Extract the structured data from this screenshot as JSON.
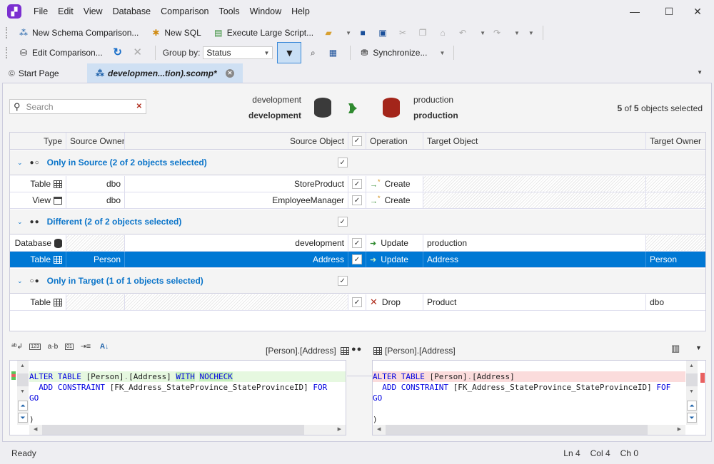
{
  "app": {
    "logo_icon": "devart-dbforge-logo-icon"
  },
  "menu": [
    "File",
    "Edit",
    "View",
    "Database",
    "Comparison",
    "Tools",
    "Window",
    "Help"
  ],
  "window_controls": {
    "minimize": "—",
    "maximize": "☐",
    "close": "✕"
  },
  "toolbar1": {
    "new_schema_comparison": "New Schema Comparison...",
    "new_sql": "New SQL",
    "execute_large_script": "Execute Large Script..."
  },
  "toolbar2": {
    "edit_comparison": "Edit Comparison...",
    "group_by_label": "Group by:",
    "group_by_value": "Status",
    "synchronize": "Synchronize..."
  },
  "tabs": [
    {
      "label": "Start Page",
      "active": false
    },
    {
      "label": "developmen...tion).scomp*",
      "active": true
    }
  ],
  "search": {
    "placeholder": "Search",
    "clear": "✕"
  },
  "source": {
    "connection": "development",
    "database": "development",
    "color": "#3a3a3a"
  },
  "target": {
    "connection": "production",
    "database": "production",
    "color": "#a3251a"
  },
  "direction_arrow_color": "#2f8a2f",
  "selection_summary": {
    "selected": "5",
    "of": "of",
    "total": "5",
    "suffix": "objects selected"
  },
  "grid": {
    "columns": [
      "Type",
      "Source Owner",
      "Source Object",
      "",
      "Operation",
      "Target Object",
      "Target Owner"
    ],
    "groups": [
      {
        "label": "Only in Source (2 of 2 objects selected)",
        "dots": "●○",
        "rows": [
          {
            "type": "Table",
            "type_icon": "table-icon",
            "source_owner": "dbo",
            "source_object": "StoreProduct",
            "checked": true,
            "operation": "Create",
            "op_icon": "create-icon",
            "target_object": "",
            "target_owner": ""
          },
          {
            "type": "View",
            "type_icon": "view-icon",
            "source_owner": "dbo",
            "source_object": "EmployeeManager",
            "checked": true,
            "operation": "Create",
            "op_icon": "create-icon",
            "target_object": "",
            "target_owner": ""
          }
        ]
      },
      {
        "label": "Different (2 of 2 objects selected)",
        "dots": "●●",
        "rows": [
          {
            "type": "Database",
            "type_icon": "database-icon",
            "source_owner": "",
            "source_object": "development",
            "checked": true,
            "operation": "Update",
            "op_icon": "update-icon",
            "target_object": "production",
            "target_owner": ""
          },
          {
            "type": "Table",
            "type_icon": "table-icon",
            "source_owner": "Person",
            "source_object": "Address",
            "checked": true,
            "operation": "Update",
            "op_icon": "update-icon",
            "target_object": "Address",
            "target_owner": "Person",
            "selected": true
          }
        ]
      },
      {
        "label": "Only in Target (1 of 1 objects selected)",
        "dots": "○●",
        "rows": [
          {
            "type": "Table",
            "type_icon": "table-icon",
            "source_owner": "",
            "source_object": "",
            "checked": true,
            "operation": "Drop",
            "op_icon": "drop-icon",
            "target_object": "Product",
            "target_owner": "dbo"
          }
        ]
      }
    ]
  },
  "diff": {
    "left_title": "[Person].[Address]",
    "right_title": "[Person].[Address]",
    "compare_dots": "●●",
    "left_code": [
      {
        "parts": [
          {
            "t": "ALTER TABLE ",
            "k": 1
          },
          {
            "t": "[Person]"
          },
          {
            "t": ".",
            "g": 1
          },
          {
            "t": "[Address] "
          },
          {
            "t": "WITH",
            "k": 1,
            "h": 1
          },
          {
            "t": " "
          },
          {
            "t": "NOCHECK",
            "k": 1,
            "h": 1
          }
        ],
        "style": "add"
      },
      {
        "parts": [
          {
            "t": "  ADD CONSTRAINT ",
            "k": 1
          },
          {
            "t": "[FK_Address_StateProvince_StateProvinceID] "
          },
          {
            "t": "FOR",
            "k": 1
          }
        ]
      },
      {
        "parts": [
          {
            "t": "GO",
            "k": 1
          }
        ]
      },
      {
        "parts": [
          {
            "t": ""
          }
        ]
      },
      {
        "parts": [
          {
            "t": ")"
          }
        ]
      }
    ],
    "right_code": [
      {
        "parts": [
          {
            "t": "ALTER TABLE ",
            "k": 1
          },
          {
            "t": "[Person]"
          },
          {
            "t": ".",
            "g": 1
          },
          {
            "t": "[Address]"
          }
        ],
        "style": "del"
      },
      {
        "parts": [
          {
            "t": "  ADD CONSTRAINT ",
            "k": 1
          },
          {
            "t": "[FK_Address_StateProvince_StateProvinceID] "
          },
          {
            "t": "FOF",
            "k": 1
          }
        ]
      },
      {
        "parts": [
          {
            "t": "GO",
            "k": 1
          }
        ]
      },
      {
        "parts": [
          {
            "t": ""
          }
        ]
      },
      {
        "parts": [
          {
            "t": ")"
          }
        ]
      }
    ]
  },
  "status": {
    "text": "Ready",
    "ln": "Ln 4",
    "col": "Col 4",
    "ch": "Ch 0"
  }
}
